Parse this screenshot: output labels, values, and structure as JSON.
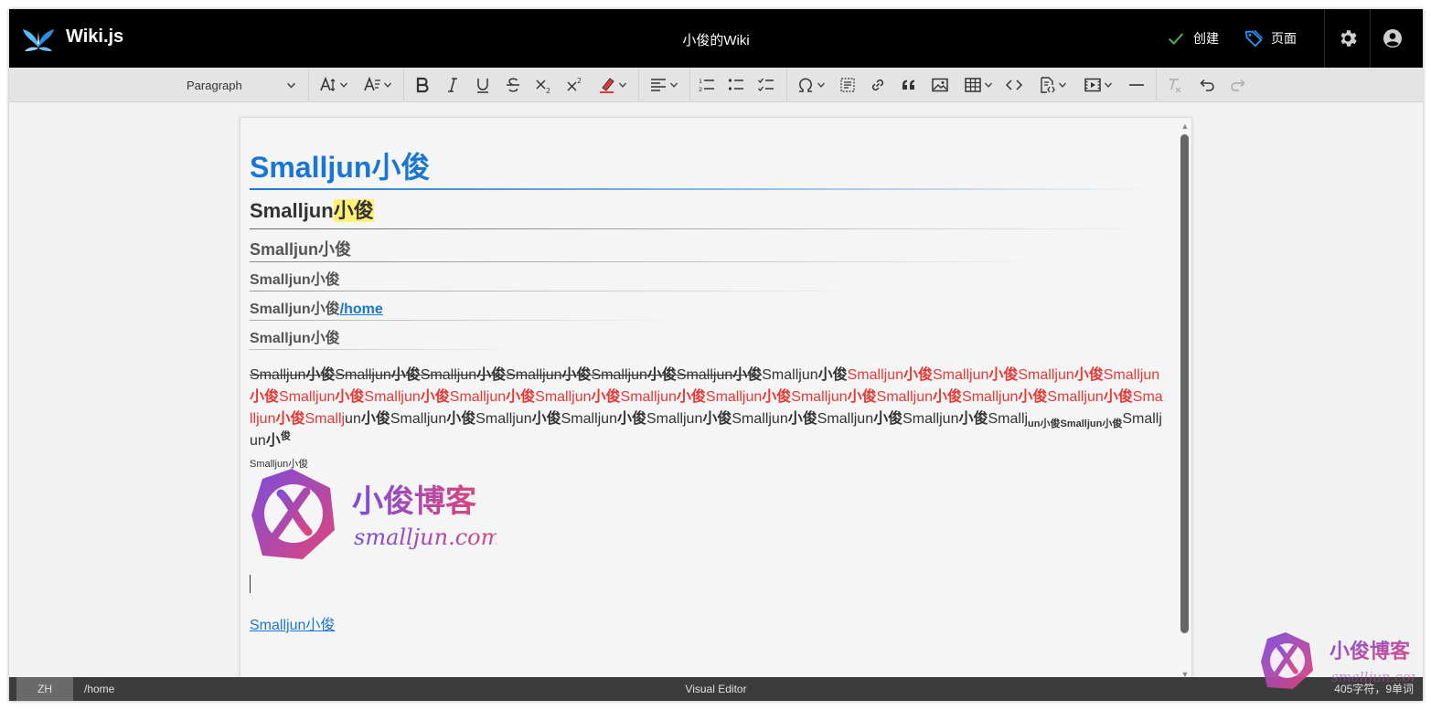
{
  "header": {
    "app_name": "Wiki.js",
    "site_title": "小俊的Wiki",
    "create_label": "创建",
    "page_label": "页面"
  },
  "toolbar": {
    "paragraph_style": "Paragraph",
    "tools": [
      "font-size",
      "text-style",
      "bold",
      "italic",
      "underline",
      "strikethrough",
      "subscript",
      "superscript",
      "highlight",
      "alignment",
      "numbered-list",
      "bullet-list",
      "todo-list",
      "special-characters",
      "insert-from-asset",
      "link",
      "blockquote",
      "image",
      "table",
      "code",
      "code-block",
      "media",
      "horizontal-line",
      "remove-format",
      "undo",
      "redo"
    ]
  },
  "document": {
    "h1": "Smalljun小俊",
    "h2_prefix": "Smalljun",
    "h2_highlight": "小俊",
    "h3": "Smalljun小俊",
    "h4": "Smalljun小俊",
    "h5_prefix": "Smalljun小俊",
    "h5_link": "/home",
    "h6": "Smalljun小俊",
    "paragraph": {
      "strike_runs": [
        "Smalljun",
        "小俊",
        "Smalljun",
        "小俊",
        "Smalljun",
        "小俊",
        "Smalljun",
        "小俊",
        "Smalljun",
        "小俊",
        "Smalljun",
        "小俊"
      ],
      "plain_after_strike": "Smalljun",
      "plain_bold_after_strike": "小俊",
      "red_runs": [
        "Smalljun",
        "小俊",
        "Smalljun",
        "小俊",
        "Smalljun",
        "小俊",
        "Smalljun",
        "小俊",
        "Smalljun",
        "小俊",
        "Smalljun",
        "小俊",
        "Smalljun",
        "小俊",
        "Smalljun",
        "小俊",
        "Smalljun",
        "小俊",
        "Smalljun",
        "小俊",
        "Smalljun",
        "小俊",
        "Smalljun",
        "小俊",
        "Smalljun",
        "小俊",
        "Smalljun",
        "小俊",
        "Smalljun",
        "小俊",
        "Smallj"
      ],
      "normal_runs": [
        "un",
        "小俊",
        "Smalljun",
        "小俊",
        "Smalljun",
        "小俊",
        "Smalljun",
        "小俊",
        "Smalljun",
        "小俊",
        "Smalljun",
        "小俊",
        "Smalljun",
        "小俊",
        "Smalljun",
        "小俊",
        "Smallj"
      ],
      "subscript_text": "un小俊Smalljun小俊",
      "after_sub": "Smalljun",
      "after_sub_bold": "小",
      "superscript_text": "俊",
      "small_line": "Smalljun小俊"
    },
    "logo_title": "小俊博客",
    "logo_subtitle": "smalljun.com",
    "link_text": "Smalljun小俊"
  },
  "statusbar": {
    "language": "ZH",
    "path": "/home",
    "mode": "Visual Editor",
    "stats": "405字符，9单词"
  },
  "watermark": {
    "title": "小俊博客",
    "subtitle": "smalljun.com"
  },
  "colors": {
    "accent": "#1976d2",
    "red": "#e53935",
    "highlight": "#fff176",
    "check": "#4caf50",
    "tag": "#2196f3"
  }
}
